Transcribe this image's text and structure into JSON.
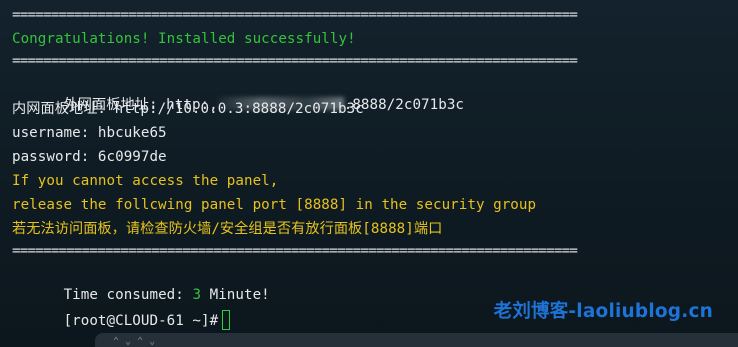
{
  "terminal": {
    "separator": "=========================================================================",
    "congrats": "Congratulations! Installed successfully!",
    "external_label": "外网面板地址: ",
    "external_url_prefix": "http:,",
    "external_url_suffix": ".8888/2c071b3c",
    "internal_line": "内网面板地址: http://10.0.0.3:8888/2c071b3c",
    "username_line": "username: hbcuke65",
    "password_line": "password: 6c0997de",
    "warn_1": "If you cannot access the panel,",
    "warn_2": "release the follcwing panel port [8888] in the security group",
    "warn_3": "若无法访问面板，请检查防火墙/安全组是否有放行面板[8888]端口",
    "time_label": "Time consumed: ",
    "time_value": "3",
    "time_unit": " Minute!",
    "prompt": "[root@CLOUD-61 ~]#"
  },
  "watermark": "老刘博客-laoliublog.cn",
  "colors": {
    "success": "#35c23d",
    "warning": "#e5c21d",
    "text": "#e6e9eb",
    "watermark": "#1d73d6",
    "cursor": "#2fd13a"
  },
  "icons": {
    "cursor": "block-cursor-icon"
  }
}
